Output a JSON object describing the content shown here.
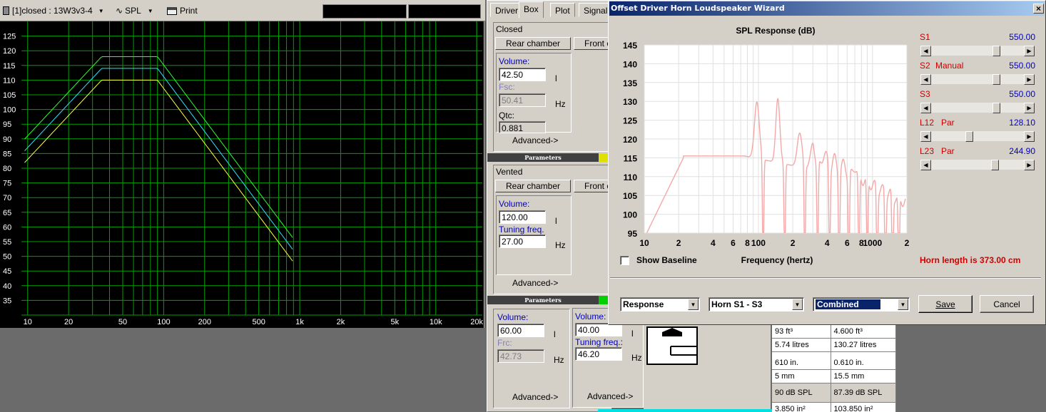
{
  "toolbar": {
    "project": "[1]closed : 13W3v3-4",
    "spl": "SPL",
    "print": "Print"
  },
  "main_chart": {
    "y_ticks": [
      "125",
      "120",
      "115",
      "110",
      "105",
      "100",
      "95",
      "90",
      "85",
      "80",
      "75",
      "70",
      "65",
      "60",
      "55",
      "50",
      "45",
      "40",
      "35"
    ],
    "x_ticks": [
      "10",
      "20",
      "50",
      "100",
      "200",
      "500",
      "1k",
      "2k",
      "5k",
      "10k",
      "20k"
    ],
    "colors": {
      "bg": "#000000",
      "grid": "#00a000",
      "c1": "#30ff30",
      "c2": "#30e0ff",
      "c3": "#ffff40"
    }
  },
  "tabs": [
    "Driver",
    "Box",
    "Plot",
    "Signal"
  ],
  "closed": {
    "title": "Closed",
    "rear_chamber": "Rear chamber",
    "front": "Front c",
    "volume_label": "Volume:",
    "volume": "42.50",
    "volume_unit": "l",
    "fsc_label": "Fsc:",
    "fsc": "50.41",
    "fsc_unit": "Hz",
    "qtc_label": "Qtc:",
    "qtc": "0.881",
    "advanced": "Advanced->"
  },
  "params_label": "Parameters",
  "vented": {
    "title": "Vented",
    "rear_chamber": "Rear chamber",
    "front": "Front c",
    "volume_label": "Volume:",
    "volume": "120.00",
    "volume_unit": "l",
    "tuning_label": "Tuning freq.",
    "tuning": "27.00",
    "tuning_unit": "Hz",
    "advanced": "Advanced->"
  },
  "bottom_left": {
    "volume_label": "Volume:",
    "volume": "60.00",
    "volume_unit": "l",
    "frc_label": "Frc:",
    "frc": "42.73",
    "frc_unit": "Hz",
    "advanced": "Advanced->"
  },
  "bottom_mid": {
    "volume_label": "Volume:",
    "volume": "40.00",
    "volume_unit": "l",
    "tuning_label": "Tuning freq.:",
    "tuning": "46.20",
    "tuning_unit": "Hz",
    "advanced": "Advanced->"
  },
  "table": {
    "rows": [
      [
        "93 ft³",
        "4.600 ft³"
      ],
      [
        "5.74 litres",
        "130.27 litres"
      ],
      [
        "610 in.",
        "0.610 in."
      ],
      [
        "5 mm",
        "15.5 mm"
      ],
      [
        "90 dB SPL",
        "87.39 dB SPL"
      ],
      [
        "3.850 in²",
        "103.850 in²"
      ]
    ]
  },
  "wizard": {
    "title": "Offset Driver Horn Loudspeaker Wizard",
    "close": "×",
    "chart": {
      "title": "SPL Response (dB)",
      "xlabel": "Frequency (hertz)",
      "y_ticks": [
        "145",
        "140",
        "135",
        "130",
        "125",
        "120",
        "115",
        "110",
        "105",
        "100",
        "95"
      ],
      "x_ticks": [
        "10",
        "2",
        "4",
        "6",
        "8",
        "100",
        "2",
        "4",
        "6",
        "8",
        "1000",
        "2"
      ]
    },
    "show_baseline": "Show Baseline",
    "horn_length": "Horn length is 373.00 cm",
    "sliders": [
      {
        "name": "S1",
        "extra": "",
        "value": "550.00",
        "pos": 0.72
      },
      {
        "name": "S2",
        "extra": "Manual",
        "value": "550.00",
        "pos": 0.72
      },
      {
        "name": "S3",
        "extra": "",
        "value": "550.00",
        "pos": 0.72
      },
      {
        "name": "L12",
        "extra": "Par",
        "value": "128.10",
        "pos": 0.4
      },
      {
        "name": "L23",
        "extra": "Par",
        "value": "244.90",
        "pos": 0.7
      }
    ],
    "combo1": "Response",
    "combo2": "Horn S1 - S3",
    "combo3": "Combined",
    "save": "Save",
    "cancel": "Cancel"
  }
}
